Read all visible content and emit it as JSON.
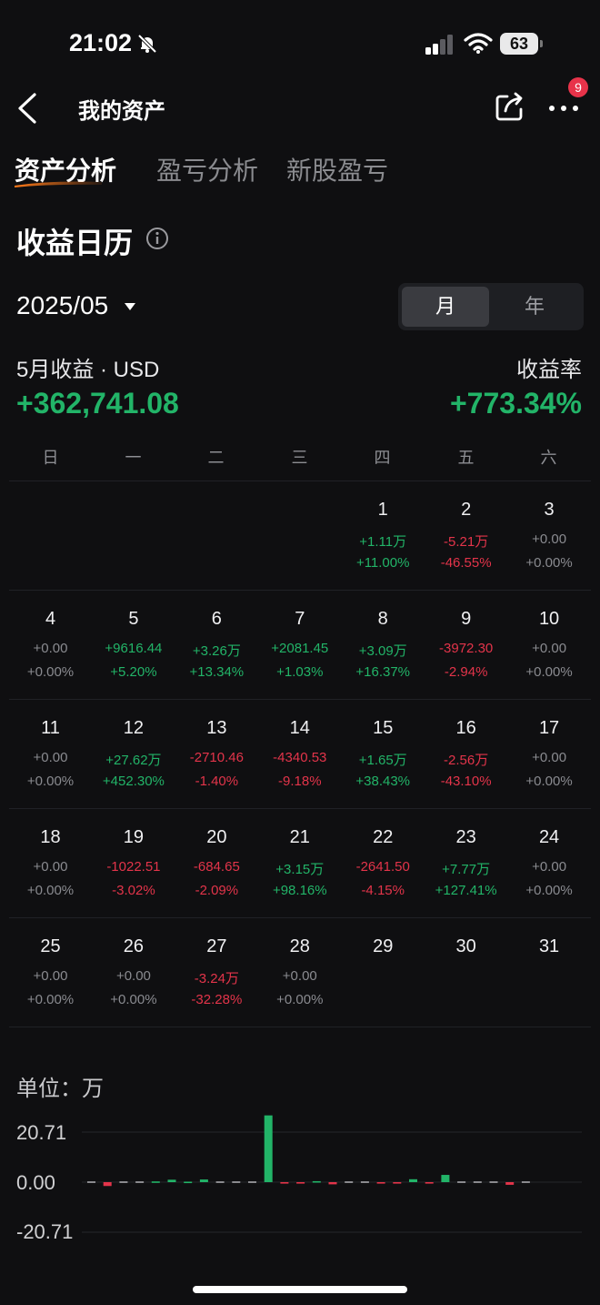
{
  "status": {
    "time": "21:02",
    "battery": "63"
  },
  "nav": {
    "title": "我的资产",
    "more_badge": "9"
  },
  "tabs": [
    {
      "label": "资产分析"
    },
    {
      "label": "盈亏分析"
    },
    {
      "label": "新股盈亏"
    }
  ],
  "section": {
    "title": "收益日历"
  },
  "period": {
    "value": "2025/05"
  },
  "toggle": {
    "month": "月",
    "year": "年"
  },
  "summary": {
    "revenue_label": "5月收益 · USD",
    "revenue_value": "+362,741.08",
    "rate_label": "收益率",
    "rate_value": "+773.34%"
  },
  "weekdays": [
    "日",
    "一",
    "二",
    "三",
    "四",
    "五",
    "六"
  ],
  "calendar": [
    {
      "day": "1",
      "amt": "+1.11万",
      "pct": "+11.00%",
      "col": 4,
      "row": 0,
      "tone": "pos"
    },
    {
      "day": "2",
      "amt": "-5.21万",
      "pct": "-46.55%",
      "col": 5,
      "row": 0,
      "tone": "neg"
    },
    {
      "day": "3",
      "amt": "+0.00",
      "pct": "+0.00%",
      "col": 6,
      "row": 0,
      "tone": "neu"
    },
    {
      "day": "4",
      "amt": "+0.00",
      "pct": "+0.00%",
      "col": 0,
      "row": 1,
      "tone": "neu"
    },
    {
      "day": "5",
      "amt": "+9616.44",
      "pct": "+5.20%",
      "col": 1,
      "row": 1,
      "tone": "pos"
    },
    {
      "day": "6",
      "amt": "+3.26万",
      "pct": "+13.34%",
      "col": 2,
      "row": 1,
      "tone": "pos"
    },
    {
      "day": "7",
      "amt": "+2081.45",
      "pct": "+1.03%",
      "col": 3,
      "row": 1,
      "tone": "pos"
    },
    {
      "day": "8",
      "amt": "+3.09万",
      "pct": "+16.37%",
      "col": 4,
      "row": 1,
      "tone": "pos"
    },
    {
      "day": "9",
      "amt": "-3972.30",
      "pct": "-2.94%",
      "col": 5,
      "row": 1,
      "tone": "neg"
    },
    {
      "day": "10",
      "amt": "+0.00",
      "pct": "+0.00%",
      "col": 6,
      "row": 1,
      "tone": "neu"
    },
    {
      "day": "11",
      "amt": "+0.00",
      "pct": "+0.00%",
      "col": 0,
      "row": 2,
      "tone": "neu"
    },
    {
      "day": "12",
      "amt": "+27.62万",
      "pct": "+452.30%",
      "col": 1,
      "row": 2,
      "tone": "pos"
    },
    {
      "day": "13",
      "amt": "-2710.46",
      "pct": "-1.40%",
      "col": 2,
      "row": 2,
      "tone": "neg"
    },
    {
      "day": "14",
      "amt": "-4340.53",
      "pct": "-9.18%",
      "col": 3,
      "row": 2,
      "tone": "neg"
    },
    {
      "day": "15",
      "amt": "+1.65万",
      "pct": "+38.43%",
      "col": 4,
      "row": 2,
      "tone": "pos"
    },
    {
      "day": "16",
      "amt": "-2.56万",
      "pct": "-43.10%",
      "col": 5,
      "row": 2,
      "tone": "neg"
    },
    {
      "day": "17",
      "amt": "+0.00",
      "pct": "+0.00%",
      "col": 6,
      "row": 2,
      "tone": "neu"
    },
    {
      "day": "18",
      "amt": "+0.00",
      "pct": "+0.00%",
      "col": 0,
      "row": 3,
      "tone": "neu"
    },
    {
      "day": "19",
      "amt": "-1022.51",
      "pct": "-3.02%",
      "col": 1,
      "row": 3,
      "tone": "neg"
    },
    {
      "day": "20",
      "amt": "-684.65",
      "pct": "-2.09%",
      "col": 2,
      "row": 3,
      "tone": "neg"
    },
    {
      "day": "21",
      "amt": "+3.15万",
      "pct": "+98.16%",
      "col": 3,
      "row": 3,
      "tone": "pos"
    },
    {
      "day": "22",
      "amt": "-2641.50",
      "pct": "-4.15%",
      "col": 4,
      "row": 3,
      "tone": "neg"
    },
    {
      "day": "23",
      "amt": "+7.77万",
      "pct": "+127.41%",
      "col": 5,
      "row": 3,
      "tone": "pos"
    },
    {
      "day": "24",
      "amt": "+0.00",
      "pct": "+0.00%",
      "col": 6,
      "row": 3,
      "tone": "neu"
    },
    {
      "day": "25",
      "amt": "+0.00",
      "pct": "+0.00%",
      "col": 0,
      "row": 4,
      "tone": "neu"
    },
    {
      "day": "26",
      "amt": "+0.00",
      "pct": "+0.00%",
      "col": 1,
      "row": 4,
      "tone": "neu"
    },
    {
      "day": "27",
      "amt": "-3.24万",
      "pct": "-32.28%",
      "col": 2,
      "row": 4,
      "tone": "neg"
    },
    {
      "day": "28",
      "amt": "+0.00",
      "pct": "+0.00%",
      "col": 3,
      "row": 4,
      "tone": "neu"
    },
    {
      "day": "29",
      "amt": "",
      "pct": "",
      "col": 4,
      "row": 4,
      "tone": "neu"
    },
    {
      "day": "30",
      "amt": "",
      "pct": "",
      "col": 5,
      "row": 4,
      "tone": "neu"
    },
    {
      "day": "31",
      "amt": "",
      "pct": "",
      "col": 6,
      "row": 4,
      "tone": "neu"
    }
  ],
  "chart_data": {
    "type": "bar",
    "unit_label": "单位：万",
    "yticks": [
      "20.71",
      "0.00",
      "-20.71"
    ],
    "ylim": [
      -20.71,
      20.71
    ],
    "values": [
      0.0,
      -1.6,
      0.0,
      0.0,
      0.3,
      1.0,
      0.2,
      1.1,
      0.0,
      0.0,
      0.0,
      27.62,
      -0.1,
      -0.1,
      0.4,
      -0.9,
      0.0,
      0.0,
      -0.1,
      -0.1,
      1.2,
      -0.1,
      3.0,
      0.0,
      0.0,
      0.0,
      -1.1,
      0.0
    ],
    "positive_color": "#22b468",
    "negative_color": "#e3344a",
    "flat_color": "#a9a9ad"
  }
}
